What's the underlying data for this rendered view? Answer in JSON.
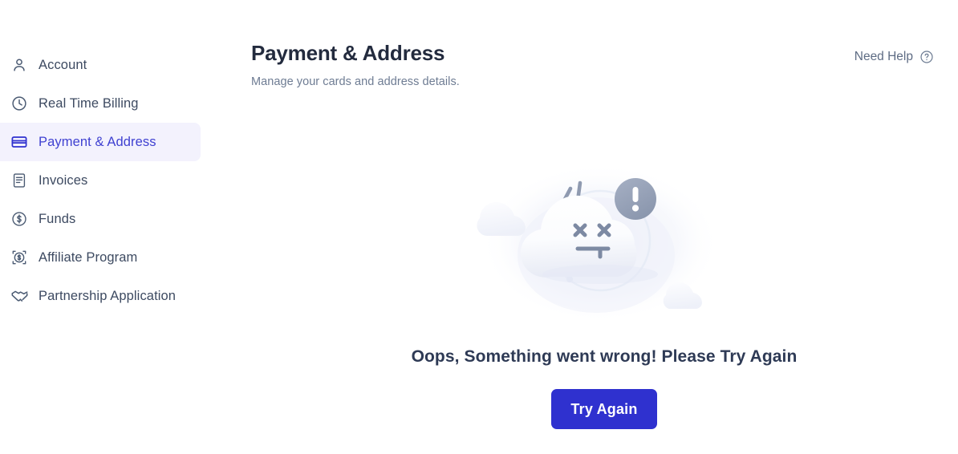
{
  "sidebar": {
    "items": [
      {
        "label": "Account",
        "icon": "user-icon",
        "active": false
      },
      {
        "label": "Real Time Billing",
        "icon": "clock-icon",
        "active": false
      },
      {
        "label": "Payment & Address",
        "icon": "credit-card-icon",
        "active": true
      },
      {
        "label": "Invoices",
        "icon": "invoice-icon",
        "active": false
      },
      {
        "label": "Funds",
        "icon": "dollar-circle-icon",
        "active": false
      },
      {
        "label": "Affiliate Program",
        "icon": "affiliate-dollar-icon",
        "active": false
      },
      {
        "label": "Partnership Application",
        "icon": "handshake-icon",
        "active": false
      }
    ]
  },
  "header": {
    "title": "Payment & Address",
    "subtitle": "Manage your cards and address details.",
    "need_help_label": "Need Help",
    "need_help_icon": "question-circle-icon"
  },
  "error_state": {
    "illustration": "sad-cloud-error-illustration",
    "message": "Oops, Something went wrong! Please Try Again",
    "button_label": "Try Again"
  },
  "colors": {
    "accent": "#2f31cf",
    "active_nav_bg": "#f3f2fd",
    "active_nav_text": "#3f41d1",
    "title": "#232b3e",
    "subtitle": "#6e7c93",
    "nav_text": "#3d4a61",
    "error_text": "#2e3a55",
    "badge_gray": "#99a3b8"
  }
}
